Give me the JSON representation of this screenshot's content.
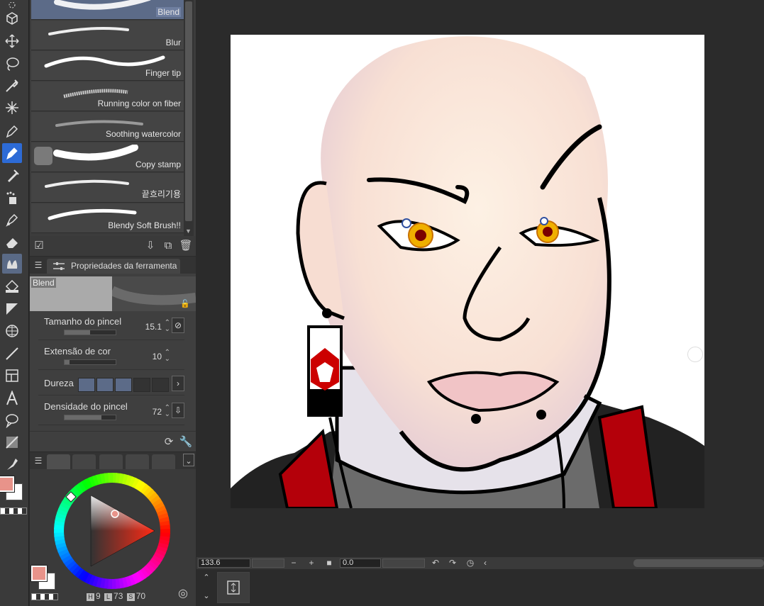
{
  "brush_list": {
    "items": [
      {
        "name": "Blend",
        "selected": true
      },
      {
        "name": "Blur",
        "selected": false
      },
      {
        "name": "Finger tip",
        "selected": false
      },
      {
        "name": "Running color on fiber",
        "selected": false
      },
      {
        "name": "Soothing watercolor",
        "selected": false
      },
      {
        "name": "Copy stamp",
        "selected": false
      },
      {
        "name": "끝흐리기용",
        "selected": false
      },
      {
        "name": "Blendy Soft Brush!!",
        "selected": false
      }
    ]
  },
  "tool_property": {
    "tab_label": "Propriedades da ferramenta",
    "preset_name": "Blend",
    "brush_size": {
      "label": "Tamanho do pincel",
      "value": "15.1",
      "fill": 0.5
    },
    "color_extension": {
      "label": "Extensão de cor",
      "value": "10",
      "fill": 0.1
    },
    "hardness": {
      "label": "Dureza",
      "level": 3,
      "steps": 5
    },
    "brush_density": {
      "label": "Densidade do pincel",
      "value": "72",
      "fill": 0.72
    }
  },
  "color_wheel": {
    "h_label": "H",
    "h_value": "9",
    "l_label": "L",
    "l_value": "73",
    "s_label": "S",
    "s_value": "70",
    "main_color": "#e8938a",
    "sub_color": "#ffffff"
  },
  "navigator": {
    "zoom_value": "133.6",
    "rotation_value": "0.0"
  },
  "colors": {
    "accent": "#2d6bd6",
    "panel": "#3c3c3c",
    "selected_brush": "#5c6b88",
    "hardness_on": "#5c6b88"
  }
}
